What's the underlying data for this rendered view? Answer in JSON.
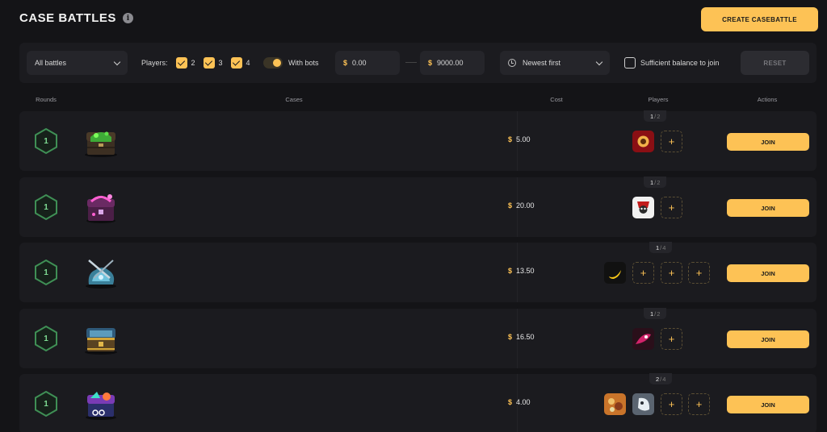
{
  "header": {
    "title": "CASE BATTLES",
    "info_icon": "i",
    "create_label": "CREATE CASEBATTLE"
  },
  "filters": {
    "battle_type": "All battles",
    "players_label": "Players:",
    "player_options": [
      {
        "label": "2",
        "checked": true
      },
      {
        "label": "3",
        "checked": true
      },
      {
        "label": "4",
        "checked": true
      }
    ],
    "with_bots_label": "With bots",
    "with_bots_on": true,
    "currency_symbol": "$",
    "price_min": "0.00",
    "price_max": "9000.00",
    "sort": "Newest first",
    "sufficient_balance_label": "Sufficient balance to join",
    "reset_label": "RESET"
  },
  "columns": {
    "rounds": "Rounds",
    "cases": "Cases",
    "cost": "Cost",
    "players": "Players",
    "actions": "Actions"
  },
  "battles": [
    {
      "rounds": "1",
      "cost": "5.00",
      "joined": "1",
      "max": "2",
      "join_label": "JOIN",
      "avatars": [
        "avatar-1"
      ],
      "slots": 1,
      "case_icon": "green-slime-chest"
    },
    {
      "rounds": "1",
      "cost": "20.00",
      "joined": "1",
      "max": "2",
      "join_label": "JOIN",
      "avatars": [
        "avatar-2"
      ],
      "slots": 1,
      "case_icon": "pink-magic-chest"
    },
    {
      "rounds": "1",
      "cost": "13.50",
      "joined": "1",
      "max": "4",
      "join_label": "JOIN",
      "avatars": [
        "avatar-3"
      ],
      "slots": 3,
      "case_icon": "blue-sword-case"
    },
    {
      "rounds": "1",
      "cost": "16.50",
      "joined": "1",
      "max": "2",
      "join_label": "JOIN",
      "avatars": [
        "avatar-4"
      ],
      "slots": 1,
      "case_icon": "golden-treasure-chest"
    },
    {
      "rounds": "1",
      "cost": "4.00",
      "joined": "2",
      "max": "4",
      "join_label": "JOIN",
      "avatars": [
        "avatar-5",
        "avatar-6"
      ],
      "slots": 2,
      "case_icon": "neon-vapor-chest"
    }
  ],
  "colors": {
    "accent": "#fdc255",
    "round_green": "#3f8f55",
    "background": "#141417",
    "panel": "#1b1b1f"
  }
}
